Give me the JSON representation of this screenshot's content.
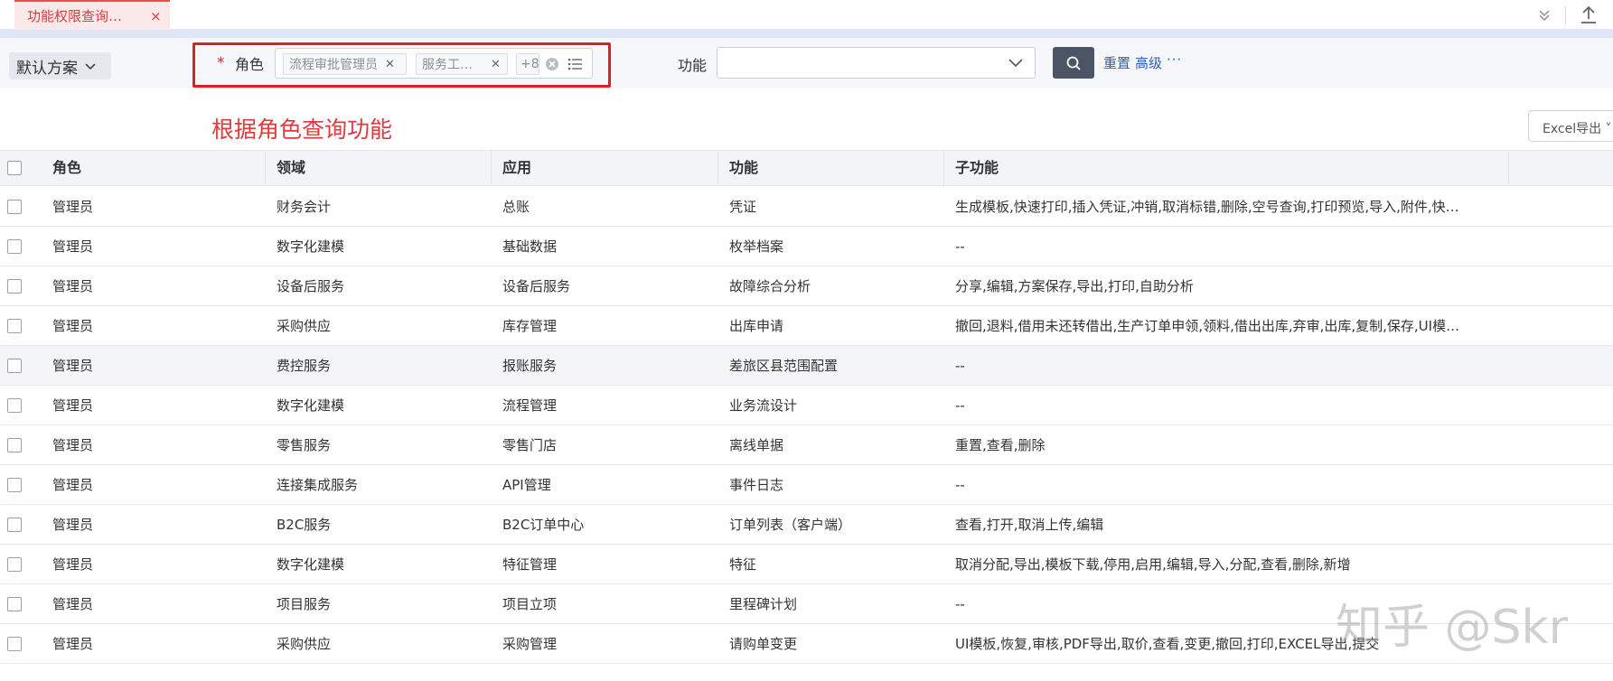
{
  "tabbar": {
    "active_tab_label": "功能权限查询…",
    "close_glyph": "×",
    "collapse_glyph": "⌄⌄"
  },
  "filters": {
    "scheme_label": "默认方案",
    "required_mark": "*",
    "role_label": "角色",
    "role_chips": [
      "流程审批管理员",
      "服务工…"
    ],
    "role_more": "+8",
    "function_label": "功能",
    "function_value": "",
    "reset_label": "重置",
    "advanced_label": "高级",
    "more_glyph": "···"
  },
  "annotation": "根据角色查询功能",
  "toolbar": {
    "excel_export_label": "Excel导出 ˅"
  },
  "table": {
    "columns": [
      "角色",
      "领域",
      "应用",
      "功能",
      "子功能"
    ],
    "rows": [
      {
        "role": "管理员",
        "domain": "财务会计",
        "app": "总账",
        "func": "凭证",
        "sub": "生成模板,快速打印,插入凭证,冲销,取消标错,删除,空号查询,打印预览,导入,附件,快…"
      },
      {
        "role": "管理员",
        "domain": "数字化建模",
        "app": "基础数据",
        "func": "枚举档案",
        "sub": "--"
      },
      {
        "role": "管理员",
        "domain": "设备后服务",
        "app": "设备后服务",
        "func": "故障综合分析",
        "sub": "分享,编辑,方案保存,导出,打印,自助分析"
      },
      {
        "role": "管理员",
        "domain": "采购供应",
        "app": "库存管理",
        "func": "出库申请",
        "sub": "撤回,退料,借用未还转借出,生产订单申领,领料,借出出库,弃审,出库,复制,保存,UI模…"
      },
      {
        "role": "管理员",
        "domain": "费控服务",
        "app": "报账服务",
        "func": "差旅区县范围配置",
        "sub": "--"
      },
      {
        "role": "管理员",
        "domain": "数字化建模",
        "app": "流程管理",
        "func": "业务流设计",
        "sub": "--"
      },
      {
        "role": "管理员",
        "domain": "零售服务",
        "app": "零售门店",
        "func": "离线单据",
        "sub": "重置,查看,删除"
      },
      {
        "role": "管理员",
        "domain": "连接集成服务",
        "app": "API管理",
        "func": "事件日志",
        "sub": "--"
      },
      {
        "role": "管理员",
        "domain": "B2C服务",
        "app": "B2C订单中心",
        "func": "订单列表（客户端）",
        "sub": "查看,打开,取消上传,编辑"
      },
      {
        "role": "管理员",
        "domain": "数字化建模",
        "app": "特征管理",
        "func": "特征",
        "sub": "取消分配,导出,模板下载,停用,启用,编辑,导入,分配,查看,删除,新增"
      },
      {
        "role": "管理员",
        "domain": "项目服务",
        "app": "项目立项",
        "func": "里程碑计划",
        "sub": "--"
      },
      {
        "role": "管理员",
        "domain": "采购供应",
        "app": "采购管理",
        "func": "请购单变更",
        "sub": "UI模板,恢复,审核,PDF导出,取价,查看,变更,撤回,打印,EXCEL导出,提交"
      }
    ]
  },
  "watermark": "知乎 @Skr",
  "colors": {
    "accent_red": "#e0393e",
    "link_blue": "#2f5fb8",
    "search_button": "#4c5565",
    "highlight_box": "#e02020"
  }
}
